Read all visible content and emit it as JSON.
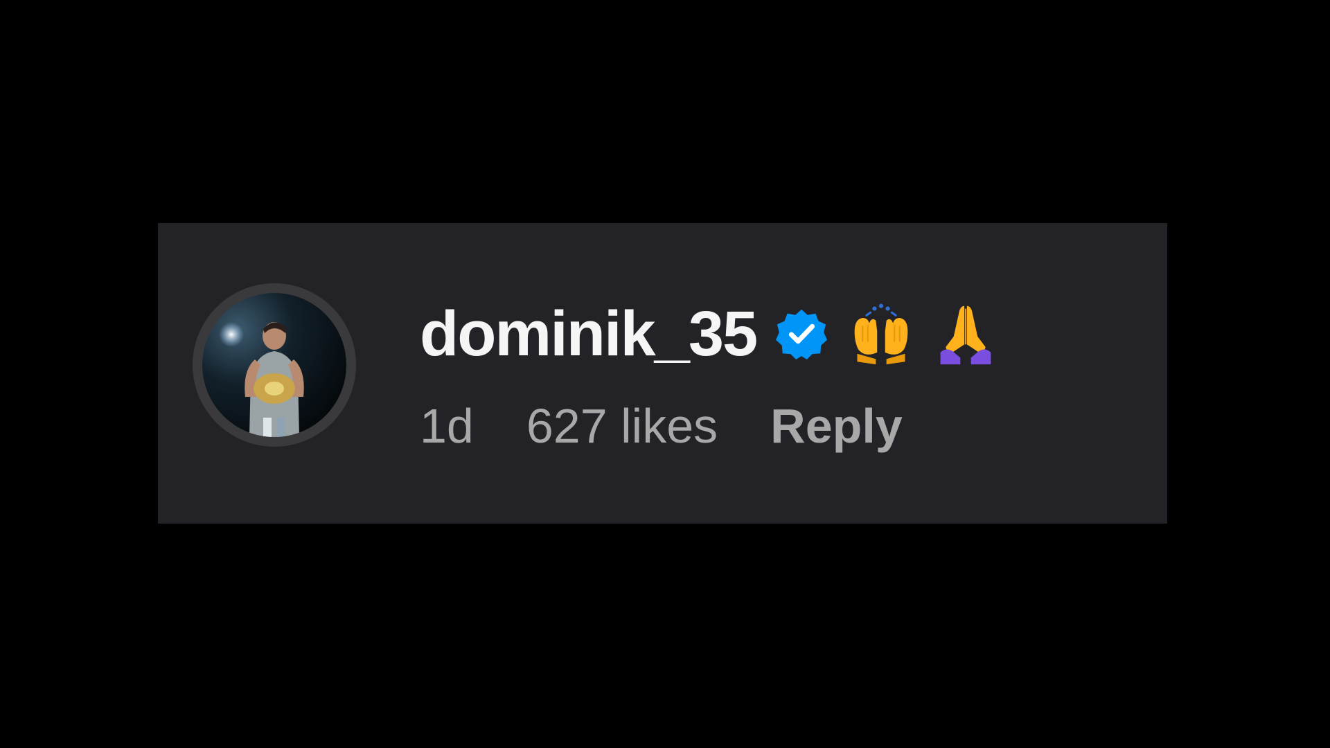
{
  "comment": {
    "avatar_icon": "user-avatar-photo",
    "username": "dominik_35",
    "verified_icon": "verified-badge-icon",
    "emojis": [
      "raising-hands-emoji",
      "folded-hands-emoji"
    ],
    "time_ago": "1d",
    "likes_text": "627 likes",
    "reply_label": "Reply"
  },
  "colors": {
    "page_background": "#000000",
    "card_background": "#232327",
    "username": "#f5f5f5",
    "meta_text": "#a8a8a8",
    "verified_badge": "#0095f6"
  }
}
